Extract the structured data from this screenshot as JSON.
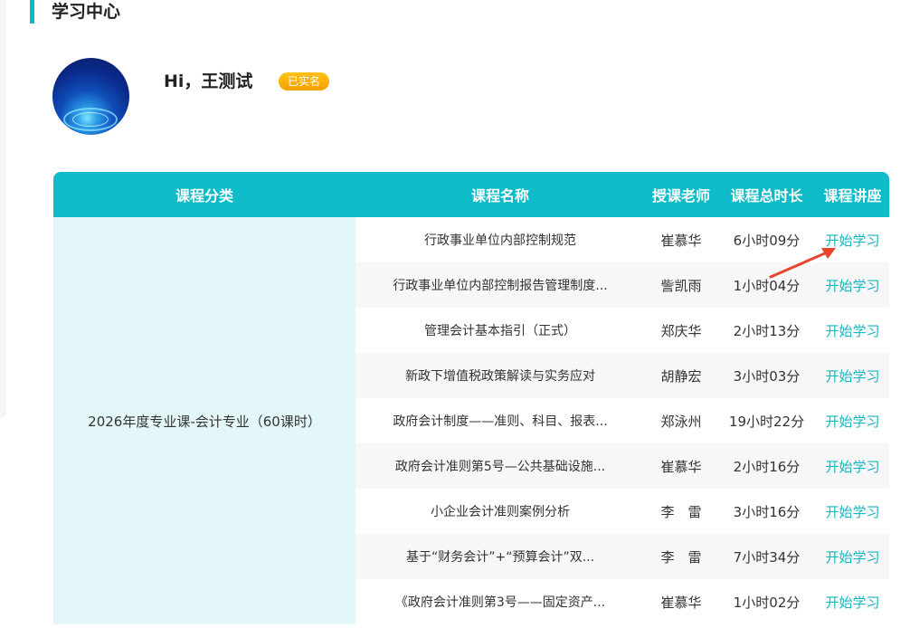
{
  "header": {
    "title": "学习中心"
  },
  "profile": {
    "greeting": "Hi，王测试",
    "badge": "已实名"
  },
  "table": {
    "columns": [
      "课程分类",
      "课程名称",
      "授课老师",
      "课程总时长",
      "课程讲座"
    ],
    "category": "2026年度专业课-会计专业（60课时）",
    "rows": [
      {
        "name": "行政事业单位内部控制规范",
        "teacher": "崔慕华",
        "duration": "6小时09分",
        "action": "开始学习"
      },
      {
        "name": "行政事业单位内部控制报告管理制度...",
        "teacher": "訾凯雨",
        "duration": "1小时04分",
        "action": "开始学习"
      },
      {
        "name": "管理会计基本指引（正式）",
        "teacher": "郑庆华",
        "duration": "2小时13分",
        "action": "开始学习"
      },
      {
        "name": "新政下增值税政策解读与实务应对",
        "teacher": "胡静宏",
        "duration": "3小时03分",
        "action": "开始学习"
      },
      {
        "name": "政府会计制度——准则、科目、报表...",
        "teacher": "郑泳州",
        "duration": "19小时22分",
        "action": "开始学习"
      },
      {
        "name": "政府会计准则第5号—公共基础设施...",
        "teacher": "崔慕华",
        "duration": "2小时16分",
        "action": "开始学习"
      },
      {
        "name": "小企业会计准则案例分析",
        "teacher": "李　雷",
        "duration": "3小时16分",
        "action": "开始学习"
      },
      {
        "name": "基于“财务会计”+“预算会计”双...",
        "teacher": "李　雷",
        "duration": "7小时34分",
        "action": "开始学习"
      },
      {
        "name": "《政府会计准则第3号——固定资产...",
        "teacher": "崔慕华",
        "duration": "1小时02分",
        "action": "开始学习"
      }
    ]
  },
  "colors": {
    "accent": "#0dbcc8",
    "link": "#18b5c2",
    "badge": "#f5a000",
    "annotation": "#e8442e"
  }
}
